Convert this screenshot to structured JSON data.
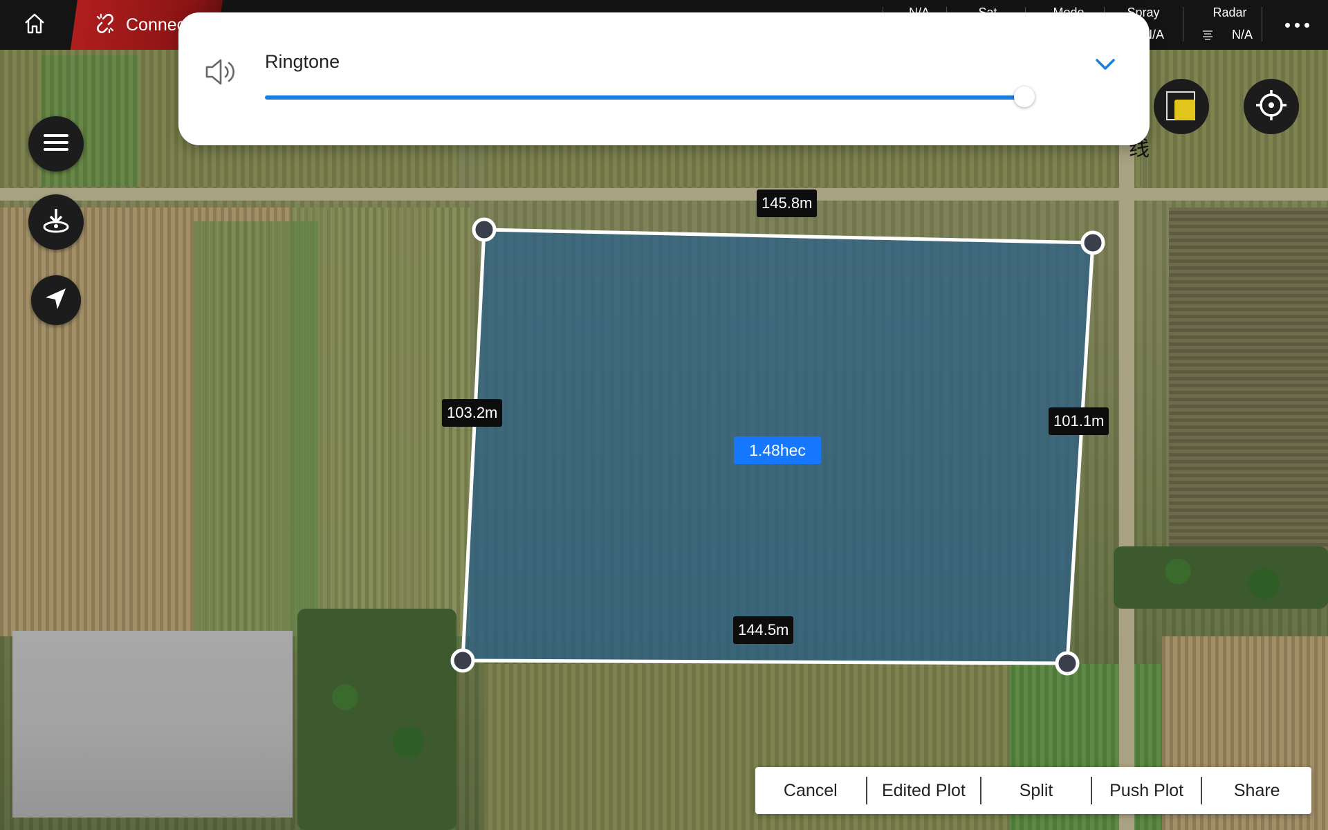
{
  "topbar": {
    "home_icon": "home-icon",
    "connection": {
      "icon": "broken-link-icon",
      "label": "Connec"
    },
    "status": [
      {
        "label": "",
        "value": ""
      },
      {
        "label": "N/A",
        "value": ""
      },
      {
        "label": "Sat",
        "value": ""
      },
      {
        "label": "Mode",
        "value": ""
      },
      {
        "label": "Spray",
        "value": "N/A"
      },
      {
        "label": "Radar",
        "value": "N/A"
      }
    ],
    "more_icon": "more-horizontal-icon"
  },
  "left_toolbar": {
    "menu_icon": "menu-icon",
    "drone_icon": "drone-takeoff-icon",
    "nav_icon": "navigation-arrow-icon"
  },
  "ringtone_dialog": {
    "speaker_icon": "speaker-icon",
    "title": "Ringtone",
    "chevron_icon": "chevron-down-icon",
    "volume_level": 0.96,
    "accent_color": "#1a7de0"
  },
  "plot": {
    "top_length": "145.8m",
    "left_length": "103.2m",
    "right_length": "101.1m",
    "bottom_length": "144.5m",
    "area": "1.48hec",
    "fill_color": "#2a5f8a",
    "area_color": "#1677ff"
  },
  "map_controls": {
    "layer_icon": "layers-icon",
    "locate_icon": "crosshair-icon",
    "map_glyph": "线"
  },
  "action_bar": {
    "cancel": "Cancel",
    "edited_plot": "Edited Plot",
    "split": "Split",
    "push_plot": "Push Plot",
    "share": "Share"
  }
}
